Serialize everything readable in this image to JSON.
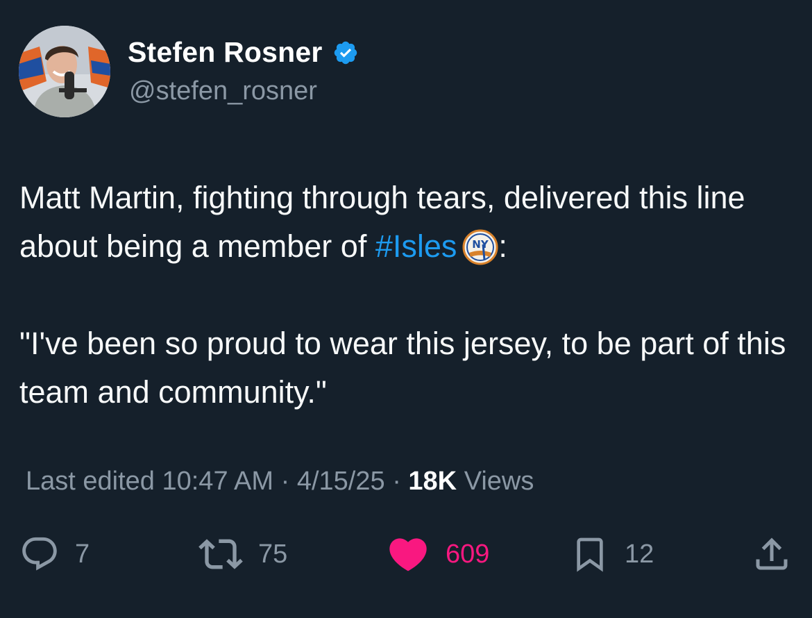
{
  "author": {
    "name": "Stefen Rosner",
    "handle": "@stefen_rosner",
    "verified": true,
    "avatar_icon": "profile-photo"
  },
  "tweet": {
    "paragraph1_text": "Matt Martin, fighting through tears, delivered this line about being a member of ",
    "hashtag": "#Isles",
    "paragraph1_after": ":",
    "hashtag_emoji_icon": "islanders-logo-icon",
    "paragraph2_text": "\"I've been so proud to wear this jersey, to be part of this team and community.\""
  },
  "meta": {
    "edited_prefix": "Last edited",
    "time": "10:47 AM",
    "separator": "·",
    "date": "4/15/25",
    "views_count": "18K",
    "views_label": "Views"
  },
  "actions": {
    "replies": "7",
    "reposts": "75",
    "likes": "609",
    "bookmarks": "12"
  },
  "colors": {
    "background": "#15202b",
    "accent": "#1d9bf0",
    "like": "#f91880",
    "secondary_text": "#8b98a5"
  }
}
